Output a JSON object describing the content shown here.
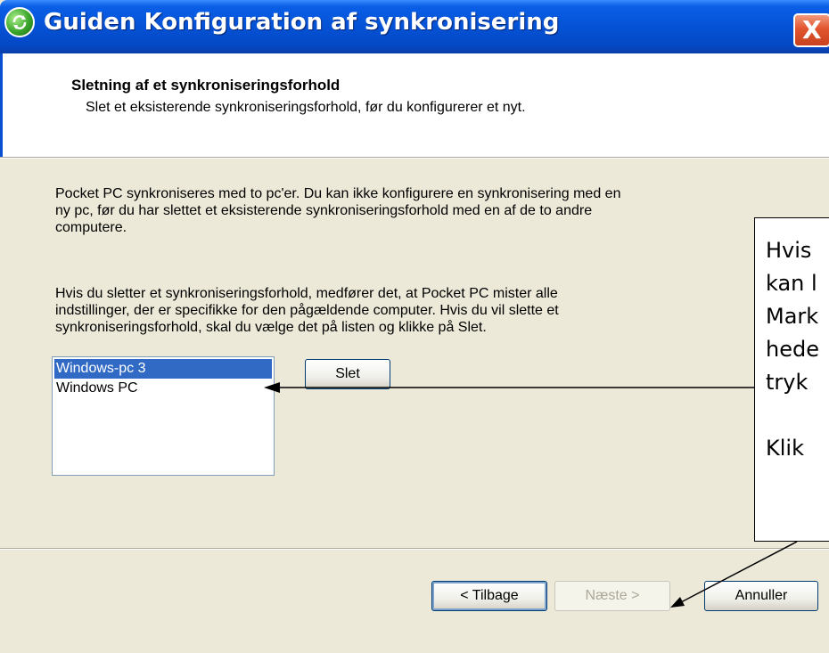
{
  "window": {
    "title": "Guiden Konfiguration af synkronisering",
    "close_label": "X"
  },
  "header": {
    "title": "Sletning af et synkroniseringsforhold",
    "subtitle": "Slet et eksisterende synkroniseringsforhold, før du konfigurerer et nyt."
  },
  "body": {
    "paragraph1": [
      "Pocket PC synkroniseres med to pc'er. Du kan ikke konfigurere en synkronisering med en",
      "ny pc, før du har slettet et eksisterende synkroniseringsforhold med en af de to andre",
      "computere."
    ],
    "paragraph2": [
      "Hvis du sletter et synkroniseringsforhold, medfører det, at Pocket PC mister alle",
      "indstillinger, der er specifikke for den pågældende computer. Hvis du vil slette et",
      "synkroniseringsforhold, skal du vælge det på listen og klikke på Slet."
    ]
  },
  "list": {
    "items": [
      {
        "label": "Windows-pc 3",
        "selected": true
      },
      {
        "label": "Windows PC",
        "selected": false
      }
    ]
  },
  "buttons": {
    "delete": "Slet",
    "back": "< Tilbage",
    "next": "Næste >",
    "cancel": "Annuller"
  },
  "callout": {
    "lines": [
      "Hvis",
      "kan l",
      "Mark",
      "hede",
      "tryk",
      "",
      "Klik"
    ]
  }
}
